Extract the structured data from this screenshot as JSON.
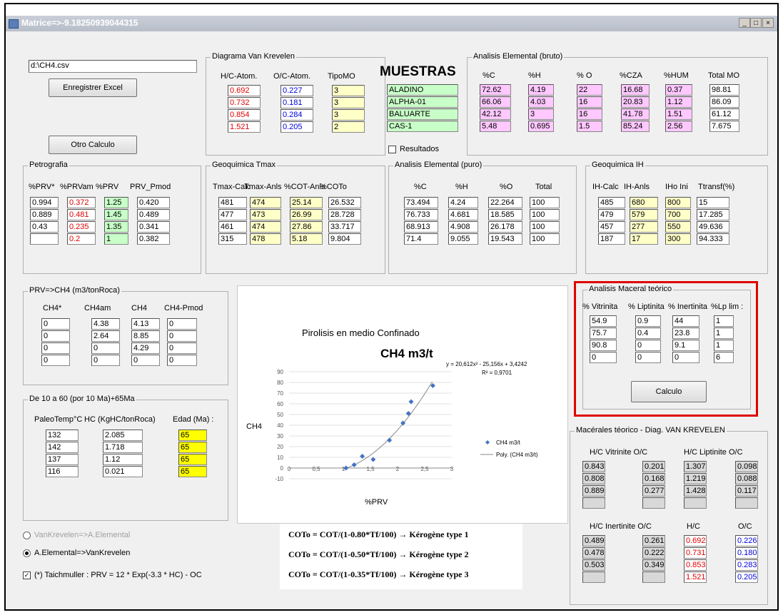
{
  "window": {
    "title": "Matrice=>-9.18250939044315",
    "min": "_",
    "max": "□",
    "close": "×"
  },
  "file": {
    "path": "d:\\CH4.csv",
    "save_button": "Enregistrer Excel",
    "otro_button": "Otro Calculo"
  },
  "vk": {
    "title": "Diagrama Van Krevelen",
    "headers": [
      "H/C-Atom.",
      "O/C-Atom.",
      "TipoMO"
    ],
    "hc": [
      "0.692",
      "0.732",
      "0.854",
      "1.521"
    ],
    "oc": [
      "0.227",
      "0.181",
      "0.284",
      "0.205"
    ],
    "tipo": [
      "3",
      "3",
      "3",
      "2"
    ]
  },
  "muestras": {
    "title": "MUESTRAS",
    "items": [
      "ALADINO",
      "ALPHA-01",
      "BALUARTE",
      "CAS-1"
    ],
    "resultados": "Resultados"
  },
  "bruto": {
    "title": "Analisis Elemental (bruto)",
    "headers": [
      "%C",
      "%H",
      "% O",
      "%CZA",
      "%HUM",
      "Total MO"
    ],
    "rows": [
      [
        "72.62",
        "4.19",
        "22",
        "16.68",
        "0.37",
        "98.81"
      ],
      [
        "66.06",
        "4.03",
        "16",
        "20.83",
        "1.12",
        "86.09"
      ],
      [
        "42.12",
        "3",
        "16",
        "41.78",
        "1.51",
        "61.12"
      ],
      [
        "5.48",
        "0.695",
        "1.5",
        "85.24",
        "2.56",
        "7.675"
      ]
    ]
  },
  "petro": {
    "title": "Petrografia",
    "headers": [
      "%PRV*",
      "%PRVam",
      "%PRV",
      "PRV_Pmod"
    ],
    "rows": [
      [
        "0.994",
        "0.372",
        "1.25",
        "0.420"
      ],
      [
        "0.889",
        "0.481",
        "1.45",
        "0.489"
      ],
      [
        "0.43",
        "0.235",
        "1.35",
        "0.341"
      ],
      [
        "",
        "0.2",
        "1",
        "0.382"
      ]
    ]
  },
  "tmax": {
    "title": "Geoquimica Tmax",
    "headers": [
      "Tmax-Calc",
      "Tmax-Anls",
      "%COT-Anls",
      "%COTo"
    ],
    "rows": [
      [
        "481",
        "474",
        "25.14",
        "26.532"
      ],
      [
        "477",
        "473",
        "26.99",
        "28.728"
      ],
      [
        "461",
        "474",
        "27.86",
        "33.717"
      ],
      [
        "315",
        "478",
        "5.18",
        "9.804"
      ]
    ]
  },
  "puro": {
    "title": "Analisis Elemental (puro)",
    "headers": [
      "%C",
      "%H",
      "%O",
      "Total"
    ],
    "rows": [
      [
        "73.494",
        "4.24",
        "22.264",
        "100"
      ],
      [
        "76.733",
        "4.681",
        "18.585",
        "100"
      ],
      [
        "68.913",
        "4.908",
        "26.178",
        "100"
      ],
      [
        "71.4",
        "9.055",
        "19.543",
        "100"
      ]
    ]
  },
  "ih": {
    "title": "Geoquimica IH",
    "headers": [
      "IH-Calc",
      "IH-Anls",
      "IHo Ini",
      "Ttransf(%)"
    ],
    "rows": [
      [
        "485",
        "680",
        "800",
        "15"
      ],
      [
        "479",
        "579",
        "700",
        "17.285"
      ],
      [
        "457",
        "277",
        "550",
        "49.636"
      ],
      [
        "187",
        "17",
        "300",
        "94.333"
      ]
    ]
  },
  "ch4": {
    "title": "PRV=>CH4 (m3/tonRoca)",
    "headers": [
      "CH4*",
      "CH4am",
      "CH4",
      "CH4-Pmod"
    ],
    "rows": [
      [
        "0",
        "4.38",
        "4.13",
        "0"
      ],
      [
        "0",
        "2.64",
        "8.85",
        "0"
      ],
      [
        "0",
        "0",
        "4.29",
        "0"
      ],
      [
        "0",
        "0",
        "0",
        "0"
      ]
    ]
  },
  "paleo": {
    "title": "De 10 a 60 (por 10 Ma)+65Ma",
    "headers": [
      "PaleoTemp°C",
      "HC (KgHC/tonRoca)",
      "Edad (Ma) :"
    ],
    "rows": [
      [
        "132",
        "2.085",
        "65"
      ],
      [
        "142",
        "1.718",
        "65"
      ],
      [
        "137",
        "1.12",
        "65"
      ],
      [
        "116",
        "0.021",
        "65"
      ]
    ]
  },
  "options": {
    "radio1": "VanKrevelen=>A.Elemental",
    "radio2": "A.Elemental=>VanKrevelen",
    "taichmuller": "(*) Taichmuller : PRV = 12 * Exp(-3.3 * HC) - OC"
  },
  "maceral": {
    "title": "Analisis Maceral teórico",
    "headers": [
      "% Vitrinita",
      "% Liptinita",
      "% Inertinita",
      "%Lp lim :"
    ],
    "rows": [
      [
        "54.9",
        "0.9",
        "44",
        "1"
      ],
      [
        "75.7",
        "0.4",
        "23.8",
        "1"
      ],
      [
        "90.8",
        "0",
        "9.1",
        "1"
      ],
      [
        "0",
        "0",
        "0",
        "6"
      ]
    ],
    "button": "Calculo"
  },
  "vkteo": {
    "title": "Macérales téorico - Diag. VAN KREVELEN",
    "vit_header": "H/C Vitrinite  O/C",
    "lip_header": "H/C  Liptinite O/C",
    "vit_hc": [
      "0.843",
      "0.808",
      "0.889",
      ""
    ],
    "vit_oc": [
      "0.201",
      "0.168",
      "0.277",
      ""
    ],
    "lip_hc": [
      "1.307",
      "1.219",
      "1.428",
      ""
    ],
    "lip_oc": [
      "0.098",
      "0.088",
      "0.117",
      ""
    ],
    "in_header": "H/C Inertinite O/C",
    "hc_header": "H/C",
    "oc_header": "O/C",
    "in_hc": [
      "0.489",
      "0.478",
      "0.503",
      ""
    ],
    "in_oc": [
      "0.261",
      "0.222",
      "0.349",
      ""
    ],
    "tot_hc": [
      "0.692",
      "0.731",
      "0.853",
      "1.521"
    ],
    "tot_oc": [
      "0.226",
      "0.180",
      "0.283",
      "0.205"
    ]
  },
  "formulas": [
    "COTo = COT/(1-0.80*Tf/100) → Kérogène type 1",
    "COTo = COT/(1-0.50*Tf/100) → Kérogène type 2",
    "COTo = COT/(1-0.35*Tf/100) → Kérogène type 3"
  ],
  "chart_data": {
    "type": "scatter",
    "title": "Pirolisis en medio Confinado",
    "subtitle": "CH4 m3/t",
    "xlabel": "%PRV",
    "ylabel": "CH4",
    "xlim": [
      0,
      3
    ],
    "ylim": [
      -10,
      90
    ],
    "xticks": [
      "0",
      "0,5",
      "1",
      "1,5",
      "2",
      "2,5",
      "3"
    ],
    "yticks": [
      "-10",
      "0",
      "10",
      "20",
      "30",
      "40",
      "50",
      "60",
      "70",
      "80",
      "90"
    ],
    "equation": "y = 20,612x² - 25,156x + 3,4242",
    "r2": "R² = 0,9701",
    "legend": [
      "CH4 m3/t",
      "Poly. (CH4 m3/t)"
    ],
    "series": [
      {
        "name": "CH4 m3/t",
        "x": [
          1.05,
          1.2,
          1.35,
          1.55,
          1.85,
          2.1,
          2.2,
          2.25,
          2.65
        ],
        "y": [
          0,
          3,
          11,
          8,
          26,
          42,
          51,
          62,
          77
        ]
      }
    ],
    "trend": {
      "a": 20.612,
      "b": -25.156,
      "c": 3.4242
    },
    "series_color": "#4472c4"
  }
}
